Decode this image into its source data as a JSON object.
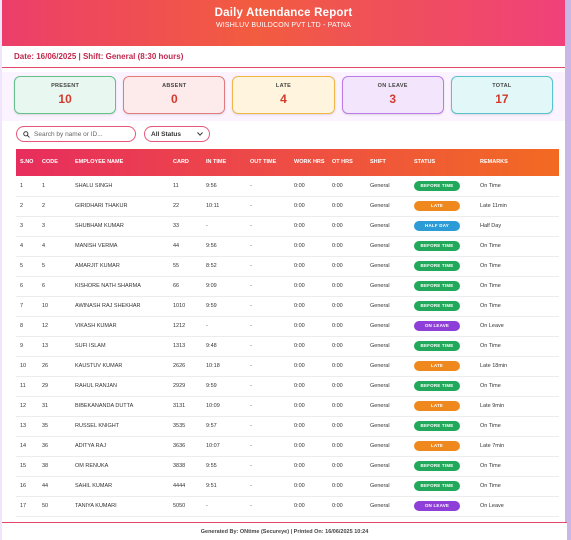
{
  "header": {
    "title": "Daily Attendance Report",
    "subtitle": "WISHLUV BUILDCON PVT LTD - PATNA"
  },
  "dateline": "Date: 16/06/2025 | Shift: General (8:30 hours)",
  "summary": [
    {
      "label": "PRESENT",
      "value": "10"
    },
    {
      "label": "ABSENT",
      "value": "0"
    },
    {
      "label": "LATE",
      "value": "4"
    },
    {
      "label": "ON LEAVE",
      "value": "3"
    },
    {
      "label": "TOTAL",
      "value": "17"
    }
  ],
  "filters": {
    "search_placeholder": "Search by name or ID...",
    "status_selected": "All Status"
  },
  "table": {
    "headers": [
      "S.NO",
      "CODE",
      "EMPLOYEE NAME",
      "CARD",
      "IN TIME",
      "OUT TIME",
      "WORK HRS",
      "OT HRS",
      "SHIFT",
      "STATUS",
      "REMARKS"
    ],
    "rows": [
      [
        "1",
        "1",
        "SHALU SINGH",
        "11",
        "9:56",
        "-",
        "0:00",
        "0:00",
        "General",
        "BEFORE TIME",
        "On Time"
      ],
      [
        "2",
        "2",
        "GIRIDHARI THAKUR",
        "22",
        "10:11",
        "-",
        "0:00",
        "0:00",
        "General",
        "LATE",
        "Late 11min"
      ],
      [
        "3",
        "3",
        "SHUBHAM KUMAR",
        "33",
        "-",
        "-",
        "0:00",
        "0:00",
        "General",
        "HALF DAY",
        "Half Day"
      ],
      [
        "4",
        "4",
        "MANISH VERMA",
        "44",
        "9:56",
        "-",
        "0:00",
        "0:00",
        "General",
        "BEFORE TIME",
        "On Time"
      ],
      [
        "5",
        "5",
        "AMARJIT KUMAR",
        "55",
        "8:52",
        "-",
        "0:00",
        "0:00",
        "General",
        "BEFORE TIME",
        "On Time"
      ],
      [
        "6",
        "6",
        "KISHORE NATH SHARMA",
        "66",
        "9:09",
        "-",
        "0:00",
        "0:00",
        "General",
        "BEFORE TIME",
        "On Time"
      ],
      [
        "7",
        "10",
        "AWINASH RAJ SHEKHAR",
        "1010",
        "9:59",
        "-",
        "0:00",
        "0:00",
        "General",
        "BEFORE TIME",
        "On Time"
      ],
      [
        "8",
        "12",
        "VIKASH KUMAR",
        "1212",
        "-",
        "-",
        "0:00",
        "0:00",
        "General",
        "ON LEAVE",
        "On Leave"
      ],
      [
        "9",
        "13",
        "SUFI ISLAM",
        "1313",
        "9:48",
        "-",
        "0:00",
        "0:00",
        "General",
        "BEFORE TIME",
        "On Time"
      ],
      [
        "10",
        "26",
        "KAUSTUV KUMAR",
        "2626",
        "10:18",
        "-",
        "0:00",
        "0:00",
        "General",
        "LATE",
        "Late 18min"
      ],
      [
        "11",
        "29",
        "RAHUL RANJAN",
        "2929",
        "9:59",
        "-",
        "0:00",
        "0:00",
        "General",
        "BEFORE TIME",
        "On Time"
      ],
      [
        "12",
        "31",
        "BIBEKANANDA DUTTA",
        "3131",
        "10:09",
        "-",
        "0:00",
        "0:00",
        "General",
        "LATE",
        "Late 9min"
      ],
      [
        "13",
        "35",
        "RUSSEL KNIGHT",
        "3535",
        "9:57",
        "-",
        "0:00",
        "0:00",
        "General",
        "BEFORE TIME",
        "On Time"
      ],
      [
        "14",
        "36",
        "ADITYA RAJ",
        "3636",
        "10:07",
        "-",
        "0:00",
        "0:00",
        "General",
        "LATE",
        "Late 7min"
      ],
      [
        "15",
        "38",
        "OM RENUKA",
        "3838",
        "9:55",
        "-",
        "0:00",
        "0:00",
        "General",
        "BEFORE TIME",
        "On Time"
      ],
      [
        "16",
        "44",
        "SAHIL KUMAR",
        "4444",
        "9:51",
        "-",
        "0:00",
        "0:00",
        "General",
        "BEFORE TIME",
        "On Time"
      ],
      [
        "17",
        "50",
        "TANIYA KUMARI",
        "5050",
        "-",
        "-",
        "0:00",
        "0:00",
        "General",
        "ON LEAVE",
        "On Leave"
      ]
    ]
  },
  "status_colors": {
    "BEFORE TIME": "#22a85a",
    "LATE": "#f0891d",
    "HALF DAY": "#2d9bd6",
    "ON LEAVE": "#8e3fd8"
  },
  "footer": "Generated By: ONtime (Secureye) | Printed On: 16/06/2025 10:24"
}
